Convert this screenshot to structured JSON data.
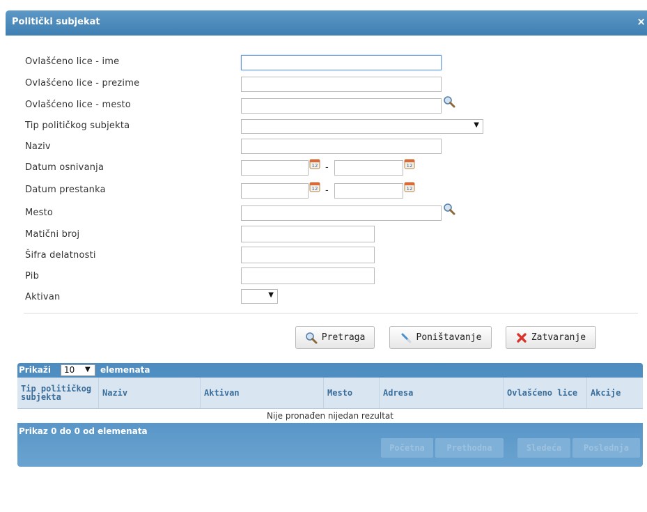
{
  "dialog": {
    "title": "Politički subjekat",
    "close_label": "×"
  },
  "form": {
    "ovlasceno_ime": {
      "label": "Ovlašćeno lice - ime",
      "value": ""
    },
    "ovlasceno_prezime": {
      "label": "Ovlašćeno lice - prezime",
      "value": ""
    },
    "ovlasceno_mesto": {
      "label": "Ovlašćeno lice - mesto",
      "value": ""
    },
    "tip": {
      "label": "Tip političkog subjekta",
      "value": ""
    },
    "naziv": {
      "label": "Naziv",
      "value": ""
    },
    "datum_osnivanja": {
      "label": "Datum osnivanja",
      "from": "",
      "to": ""
    },
    "datum_prestanka": {
      "label": "Datum prestanka",
      "from": "",
      "to": ""
    },
    "mesto": {
      "label": "Mesto",
      "value": ""
    },
    "maticni_broj": {
      "label": "Matični broj",
      "value": ""
    },
    "sifra_delatnosti": {
      "label": "Šifra delatnosti",
      "value": ""
    },
    "pib": {
      "label": "Pib",
      "value": ""
    },
    "aktivan": {
      "label": "Aktivan",
      "value": ""
    },
    "range_separator": "-"
  },
  "actions": {
    "search_label": "Pretraga",
    "reset_label": "Poništavanje",
    "close_label": "Zatvaranje"
  },
  "grid": {
    "show_label": "Prikaži",
    "page_size": "10",
    "elements_label": "elemenata",
    "columns": [
      "Tip političkog subjekta",
      "Naziv",
      "Aktivan",
      "Mesto",
      "Adresa",
      "Ovlašćeno lice",
      "Akcije"
    ],
    "empty_message": "Nije pronađen nijedan rezultat",
    "info": "Prikaz 0 do 0 od elemenata",
    "pager": {
      "first": "Početna",
      "prev": "Prethodna",
      "next": "Sledeća",
      "last": "Poslednja"
    }
  },
  "colors": {
    "header_blue": "#4a88bb",
    "grid_header_text": "#3a6d99",
    "close_icon_red": "#d9342b"
  }
}
